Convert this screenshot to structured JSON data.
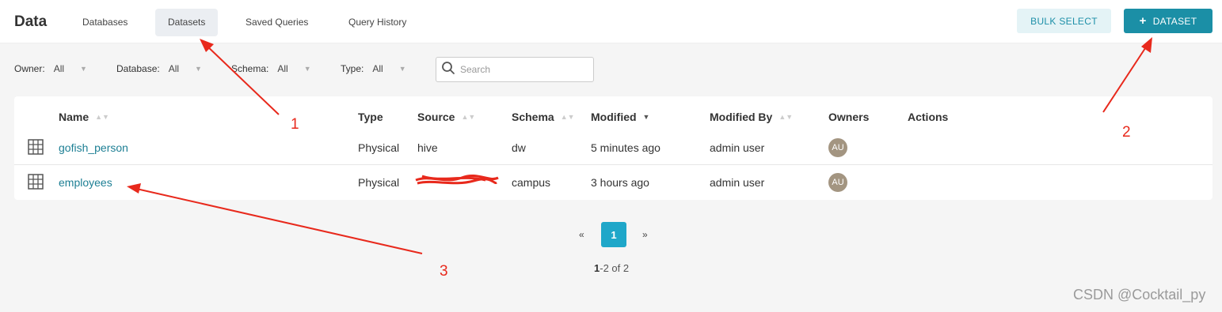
{
  "header": {
    "title": "Data",
    "tabs": [
      {
        "label": "Databases"
      },
      {
        "label": "Datasets",
        "active": true
      },
      {
        "label": "Saved Queries"
      },
      {
        "label": "Query History"
      }
    ],
    "bulk_select_label": "BULK SELECT",
    "add_dataset_label": "DATASET"
  },
  "filters": [
    {
      "label": "Owner:",
      "value": "All"
    },
    {
      "label": "Database:",
      "value": "All"
    },
    {
      "label": "Schema:",
      "value": "All"
    },
    {
      "label": "Type:",
      "value": "All"
    }
  ],
  "search": {
    "placeholder": "Search",
    "value": ""
  },
  "table": {
    "columns": [
      "Name",
      "Type",
      "Source",
      "Schema",
      "Modified",
      "Modified By",
      "Owners",
      "Actions"
    ],
    "rows": [
      {
        "name": "gofish_person",
        "type": "Physical",
        "source": "hive",
        "schema": "dw",
        "modified": "5 minutes ago",
        "modified_by": "admin user",
        "owner": "AU"
      },
      {
        "name": "employees",
        "type": "Physical",
        "source": "",
        "schema": "campus",
        "modified": "3 hours ago",
        "modified_by": "admin user",
        "owner": "AU"
      }
    ]
  },
  "pagination": {
    "prev": "«",
    "current": "1",
    "next": "»",
    "range_bold": "1",
    "range_rest": "-2 of 2"
  },
  "annotations": [
    "1",
    "2",
    "3"
  ],
  "watermark": "CSDN @Cocktail_py",
  "colors": {
    "accent": "#1b8fa6",
    "link": "#1d7f94",
    "annotation": "#e8291c",
    "avatar": "#a39581"
  }
}
